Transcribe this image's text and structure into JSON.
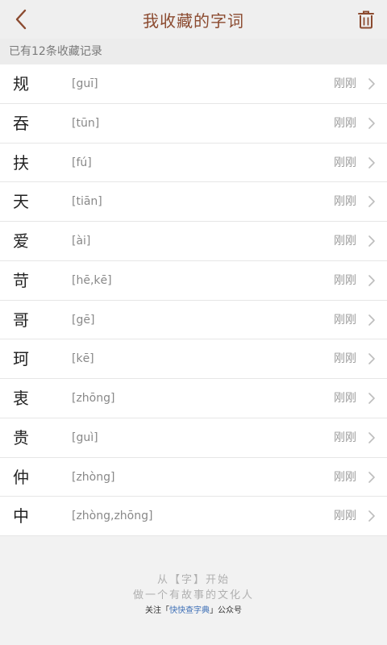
{
  "header": {
    "title": "我收藏的字词",
    "back_icon": "chevron-left-icon",
    "trash_icon": "trash-icon",
    "accent_color": "#8b4a2f"
  },
  "count_text": "已有12条收藏记录",
  "items": [
    {
      "char": "规",
      "pinyin": "[guī]",
      "time": "刚刚"
    },
    {
      "char": "吞",
      "pinyin": "[tūn]",
      "time": "刚刚"
    },
    {
      "char": "扶",
      "pinyin": "[fú]",
      "time": "刚刚"
    },
    {
      "char": "天",
      "pinyin": "[tiān]",
      "time": "刚刚"
    },
    {
      "char": "爱",
      "pinyin": "[ài]",
      "time": "刚刚"
    },
    {
      "char": "苛",
      "pinyin": "[hē,kē]",
      "time": "刚刚"
    },
    {
      "char": "哥",
      "pinyin": "[gē]",
      "time": "刚刚"
    },
    {
      "char": "珂",
      "pinyin": "[kē]",
      "time": "刚刚"
    },
    {
      "char": "衷",
      "pinyin": "[zhōng]",
      "time": "刚刚"
    },
    {
      "char": "贵",
      "pinyin": "[guì]",
      "time": "刚刚"
    },
    {
      "char": "仲",
      "pinyin": "[zhòng]",
      "time": "刚刚"
    },
    {
      "char": "中",
      "pinyin": "[zhòng,zhōng]",
      "time": "刚刚"
    }
  ],
  "footer": {
    "line1": "从【字】开始",
    "line2": "做一个有故事的文化人",
    "line3_prefix": "关注「",
    "line3_highlight": "快快查字典",
    "line3_suffix": "」公众号"
  }
}
